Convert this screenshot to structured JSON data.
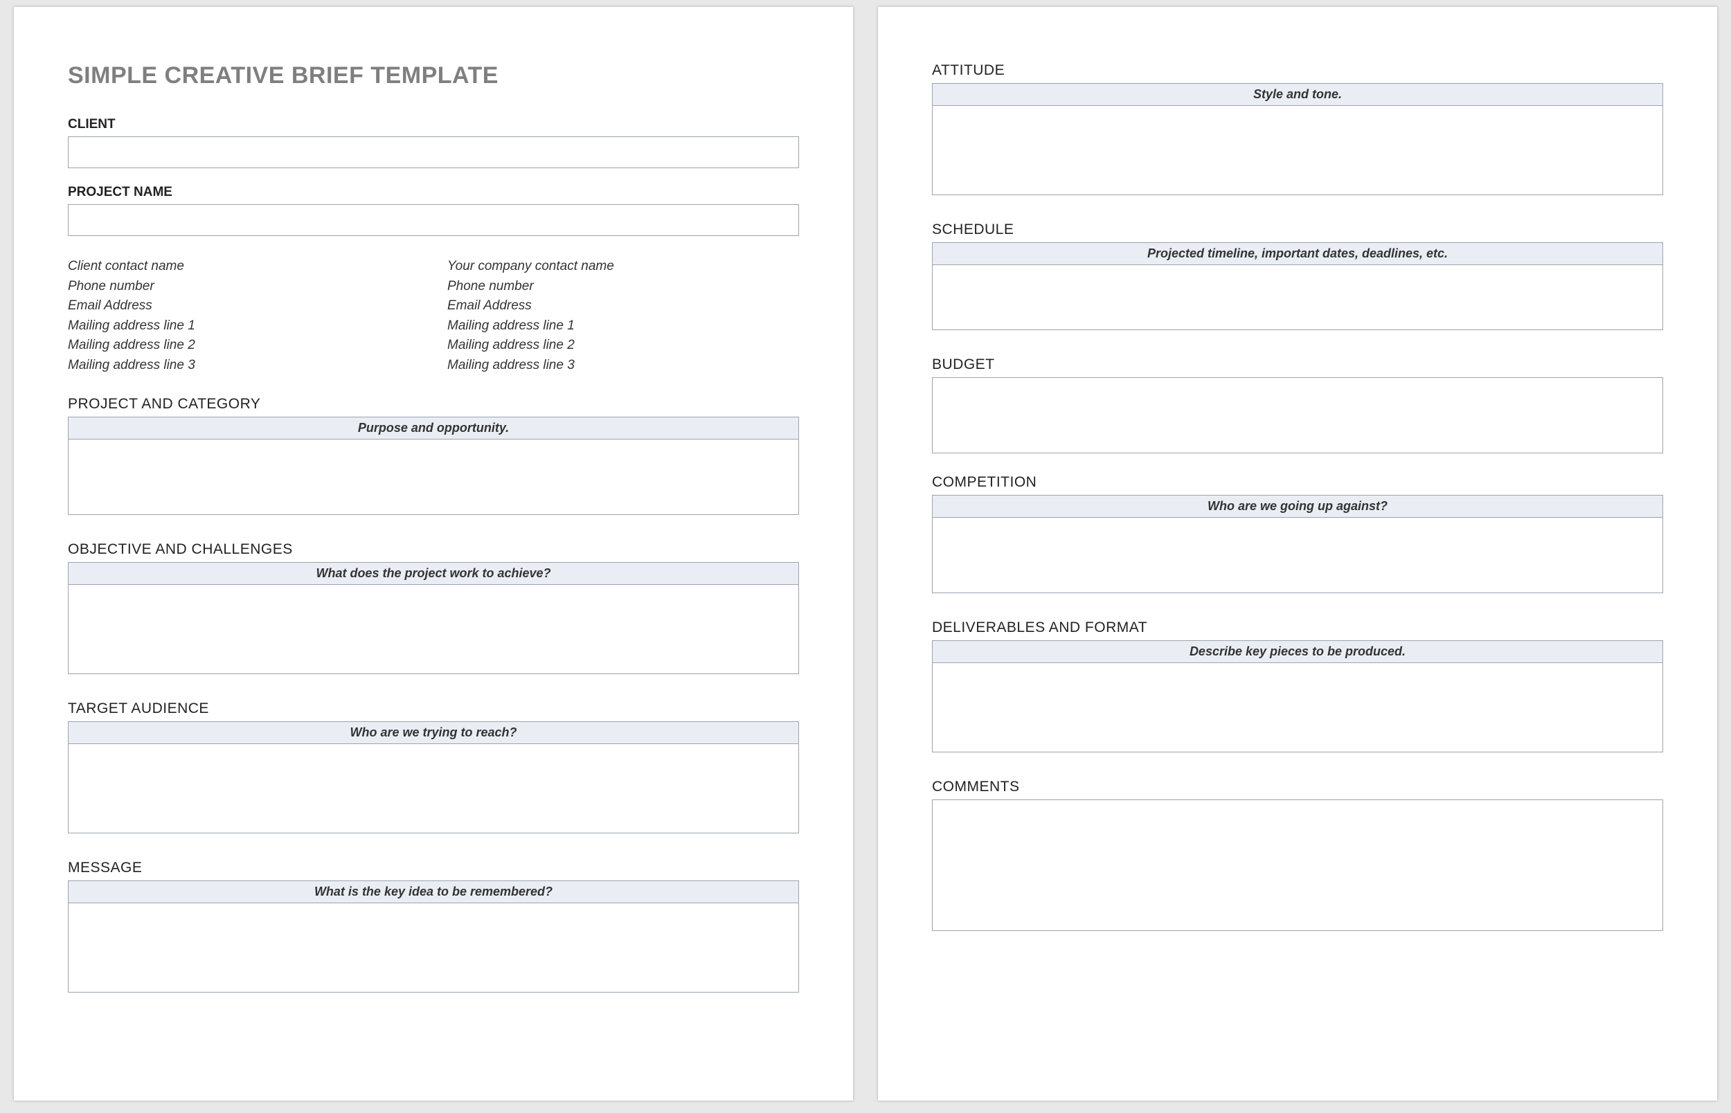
{
  "title": "SIMPLE CREATIVE BRIEF TEMPLATE",
  "fields": {
    "client_label": "CLIENT",
    "project_name_label": "PROJECT NAME"
  },
  "contacts": {
    "client": [
      "Client contact name",
      "Phone number",
      "Email Address",
      "Mailing address line 1",
      "Mailing address line 2",
      "Mailing address line 3"
    ],
    "company": [
      "Your company contact name",
      "Phone number",
      "Email Address",
      "Mailing address line 1",
      "Mailing address line 2",
      "Mailing address line 3"
    ]
  },
  "sections": {
    "project_category": {
      "heading": "PROJECT AND CATEGORY",
      "desc": "Purpose and opportunity."
    },
    "objective": {
      "heading": "OBJECTIVE AND CHALLENGES",
      "desc": "What does the project work to achieve?"
    },
    "target": {
      "heading": "TARGET AUDIENCE",
      "desc": "Who are we trying to reach?"
    },
    "message": {
      "heading": "MESSAGE",
      "desc": "What is the key idea to be remembered?"
    },
    "attitude": {
      "heading": "ATTITUDE",
      "desc": "Style and tone."
    },
    "schedule": {
      "heading": "SCHEDULE",
      "desc": "Projected timeline, important dates, deadlines, etc."
    },
    "budget": {
      "heading": "BUDGET",
      "desc": ""
    },
    "competition": {
      "heading": "COMPETITION",
      "desc": "Who are we going up against?"
    },
    "deliverables": {
      "heading": "DELIVERABLES AND FORMAT",
      "desc": "Describe key pieces to be produced."
    },
    "comments": {
      "heading": "COMMENTS",
      "desc": ""
    }
  }
}
